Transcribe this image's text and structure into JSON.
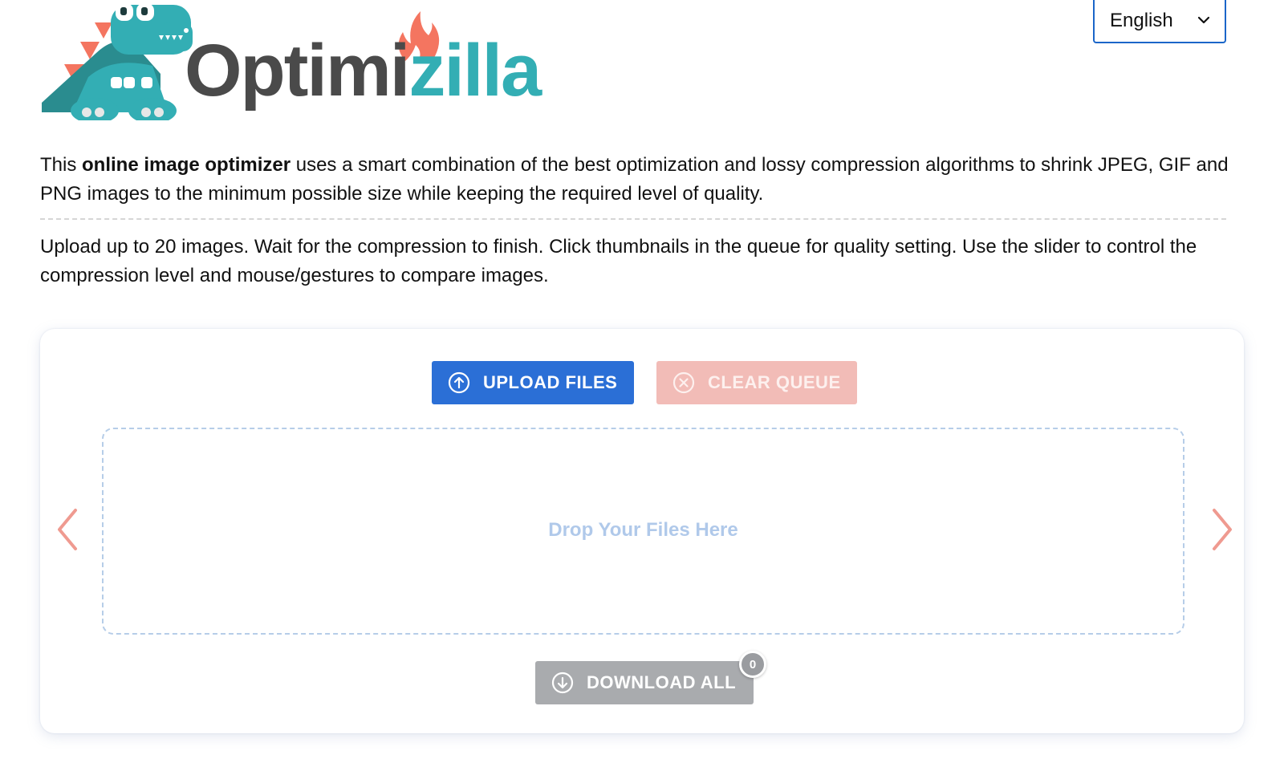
{
  "header": {
    "logo_text_dark": "Optimi",
    "logo_text_teal": "zilla",
    "language": "English"
  },
  "intro": {
    "prefix": "This ",
    "bold": "online image optimizer",
    "rest": " uses a smart combination of the best optimization and lossy compression algorithms to shrink JPEG, GIF and PNG images to the minimum possible size while keeping the required level of quality."
  },
  "instructions": "Upload up to 20 images. Wait for the compression to finish. Click thumbnails in the queue for quality setting. Use the slider to control the compression level and mouse/gestures to compare images.",
  "tool": {
    "upload_label": "UPLOAD FILES",
    "clear_label": "CLEAR QUEUE",
    "drop_text": "Drop Your Files Here",
    "download_label": "DOWNLOAD ALL",
    "download_count": "0"
  },
  "icons": {
    "upload": "arrow-up-circle-icon",
    "clear": "x-circle-icon",
    "download": "arrow-down-circle-icon",
    "prev": "chevron-left-icon",
    "next": "chevron-right-icon",
    "language": "chevron-down-icon"
  },
  "colors": {
    "upload_button": "#2b6fd6",
    "clear_button": "#f2bcb7",
    "download_button": "#a9abae",
    "logo_teal": "#33aeb4",
    "logo_dark": "#4a4a4a",
    "logo_flame": "#f47560",
    "nav_arrows": "#ef9a90",
    "dropzone_border": "#b6cde8"
  }
}
